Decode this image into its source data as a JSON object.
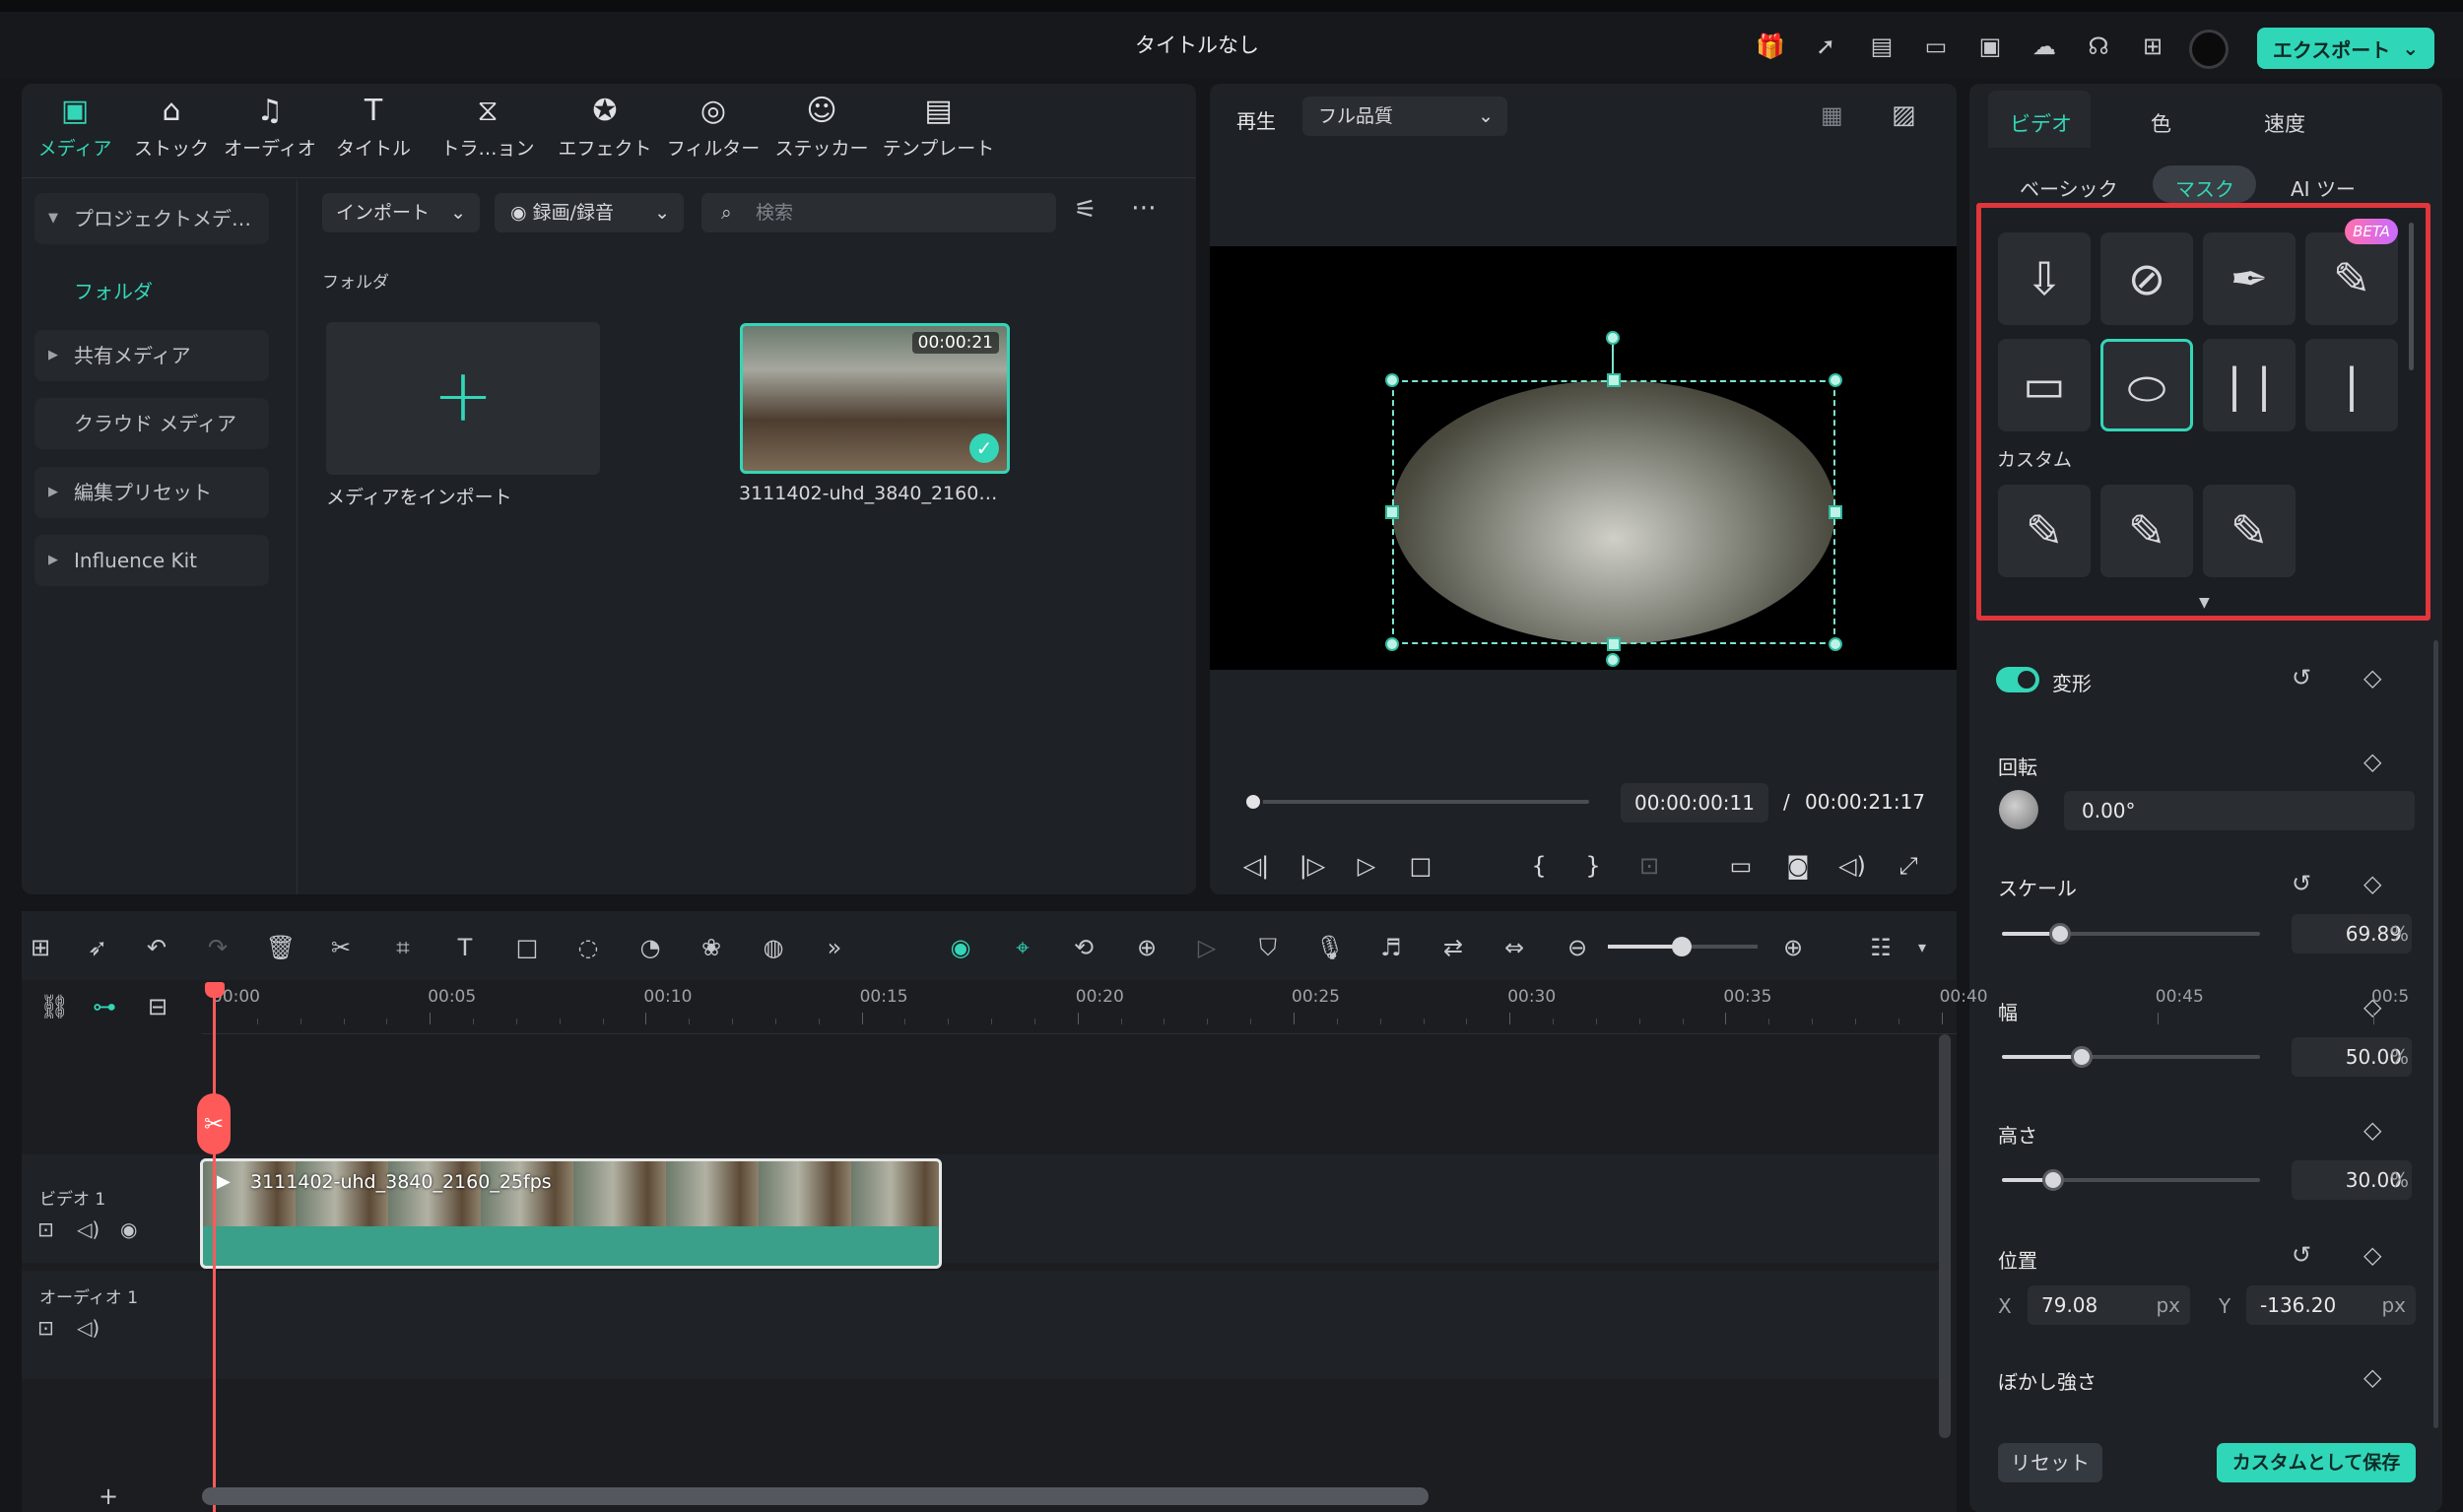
{
  "window": {
    "title": "タイトルなし"
  },
  "topbar": {
    "icons": [
      "gift-icon",
      "send-icon",
      "clipboard-icon",
      "layout-icon",
      "save-icon",
      "cloud-icon",
      "headset-icon",
      "grid-icon"
    ],
    "export_label": "エクスポート"
  },
  "media_tabs": [
    {
      "label": "メディア",
      "icon": "media-icon",
      "active": true
    },
    {
      "label": "ストック",
      "icon": "store-icon"
    },
    {
      "label": "オーディオ",
      "icon": "music-icon"
    },
    {
      "label": "タイトル",
      "icon": "title-icon"
    },
    {
      "label": "トラ…ョン",
      "icon": "transition-icon"
    },
    {
      "label": "エフェクト",
      "icon": "effect-icon"
    },
    {
      "label": "フィルター",
      "icon": "filter-icon"
    },
    {
      "label": "ステッカー",
      "icon": "sticker-icon"
    },
    {
      "label": "テンプレート",
      "icon": "template-icon"
    }
  ],
  "sidebar": {
    "items": [
      {
        "label": "プロジェクトメデ…",
        "expanded": true
      },
      {
        "label": "フォルダ"
      },
      {
        "label": "共有メディア"
      },
      {
        "label": "クラウド メディア"
      },
      {
        "label": "編集プリセット"
      },
      {
        "label": "Influence Kit"
      }
    ]
  },
  "media_toolbar": {
    "import_label": "インポート",
    "record_label": "録画/録音",
    "search_placeholder": "検索"
  },
  "media_library": {
    "folder_label": "フォルダ",
    "import_tile_label": "メディアをインポート",
    "clip": {
      "name": "3111402-uhd_3840_2160…",
      "duration": "00:00:21"
    }
  },
  "preview": {
    "label": "再生",
    "quality": "フル品質",
    "current_time": "00:00:00:11",
    "separator": "/",
    "total_time": "00:00:21:17",
    "progress": 0.005
  },
  "right_panel": {
    "tabs": [
      "ビデオ",
      "色",
      "速度"
    ],
    "active_tab": "ビデオ",
    "sub_tabs": [
      "ベーシック",
      "マスク",
      "AI ツー"
    ],
    "active_sub_tab": "マスク",
    "beta_label": "BETA",
    "custom_label": "カスタム",
    "transform_label": "変形",
    "rotation": {
      "label": "回転",
      "value": "0.00°"
    },
    "scale": {
      "label": "スケール",
      "value": "69.89",
      "unit": "%",
      "fraction": 0.2267
    },
    "width": {
      "label": "幅",
      "value": "50.00",
      "unit": "%",
      "fraction": 0.31
    },
    "height": {
      "label": "高さ",
      "value": "30.00",
      "unit": "%",
      "fraction": 0.2
    },
    "position": {
      "label": "位置",
      "x_label": "X",
      "x_value": "79.08",
      "y_label": "Y",
      "y_value": "-136.20",
      "unit": "px"
    },
    "blur_label": "ぼかし強さ",
    "reset_label": "リセット",
    "save_custom_label": "カスタムとして保存",
    "accent_color": "#2fd7b8",
    "highlight_color": "#e0363c"
  },
  "timeline": {
    "ticks": [
      "00:00",
      "00:05",
      "00:10",
      "00:15",
      "00:20",
      "00:25",
      "00:30",
      "00:35",
      "00:40",
      "00:45",
      "00:5"
    ],
    "tracks": [
      {
        "name": "ビデオ 1"
      },
      {
        "name": "オーディオ 1"
      }
    ],
    "clip_label": "3111402-uhd_3840_2160_25fps",
    "add_label": "+"
  }
}
